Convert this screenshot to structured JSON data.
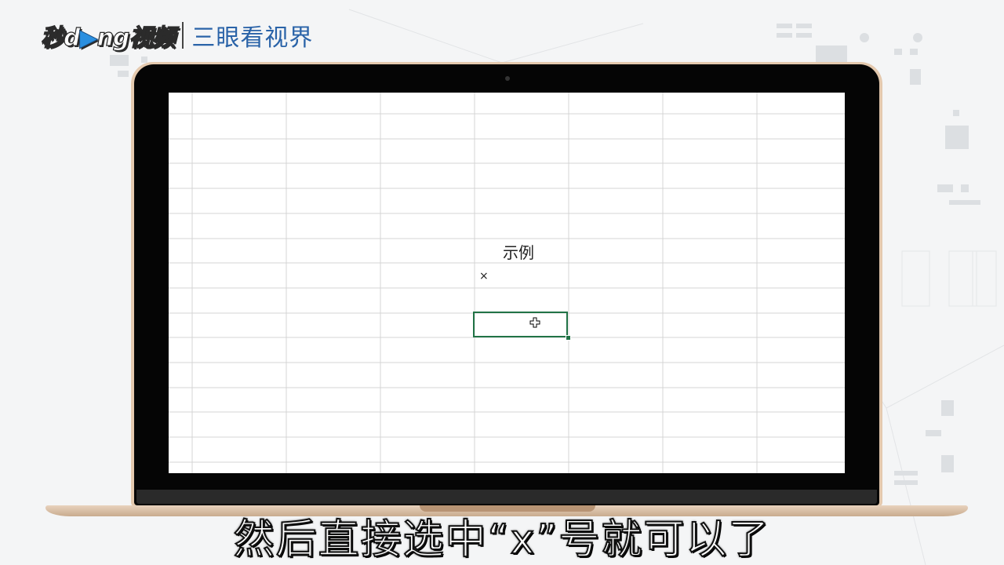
{
  "logo": {
    "brand_part1": "秒",
    "brand_part2": "d",
    "brand_part3": "ng视频",
    "partner": "三眼看视界"
  },
  "spreadsheet": {
    "cell_title": "示例",
    "cell_symbol": "×"
  },
  "subtitle": "然后直接选中“x”号就可以了",
  "colors": {
    "selection_border": "#217346",
    "laptop_frame": "#e4c9ae",
    "partner_text": "#2a63a8"
  }
}
